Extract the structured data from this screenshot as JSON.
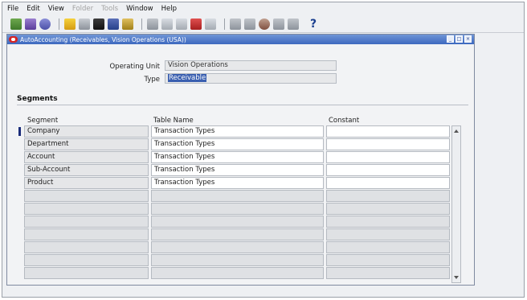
{
  "menubar": {
    "items": [
      {
        "label": "File",
        "enabled": true
      },
      {
        "label": "Edit",
        "enabled": true
      },
      {
        "label": "View",
        "enabled": true
      },
      {
        "label": "Folder",
        "enabled": false
      },
      {
        "label": "Tools",
        "enabled": false
      },
      {
        "label": "Window",
        "enabled": true
      },
      {
        "label": "Help",
        "enabled": true
      }
    ]
  },
  "toolbar": {
    "help_glyph": "?"
  },
  "window": {
    "title": "AutoAccounting (Receivables, Vision Operations (USA))",
    "controls": [
      "minimize",
      "maximize",
      "close"
    ]
  },
  "form": {
    "operating_unit_label": "Operating Unit",
    "operating_unit_value": "Vision Operations",
    "type_label": "Type",
    "type_value": "Receivable"
  },
  "segments": {
    "section_title": "Segments",
    "columns": {
      "segment": "Segment",
      "table_name": "Table Name",
      "constant": "Constant"
    },
    "rows": [
      {
        "segment": "Company",
        "table_name": "Transaction Types",
        "constant": ""
      },
      {
        "segment": "Department",
        "table_name": "Transaction Types",
        "constant": ""
      },
      {
        "segment": "Account",
        "table_name": "Transaction Types",
        "constant": ""
      },
      {
        "segment": "Sub-Account",
        "table_name": "Transaction Types",
        "constant": ""
      },
      {
        "segment": "Product",
        "table_name": "Transaction Types",
        "constant": ""
      },
      {
        "segment": "",
        "table_name": "",
        "constant": ""
      },
      {
        "segment": "",
        "table_name": "",
        "constant": ""
      },
      {
        "segment": "",
        "table_name": "",
        "constant": ""
      },
      {
        "segment": "",
        "table_name": "",
        "constant": ""
      },
      {
        "segment": "",
        "table_name": "",
        "constant": ""
      },
      {
        "segment": "",
        "table_name": "",
        "constant": ""
      },
      {
        "segment": "",
        "table_name": "",
        "constant": ""
      }
    ]
  },
  "colors": {
    "title_bar": "#3d68bf",
    "selection": "#3a5fb0",
    "indicator": "#1a2c7a"
  }
}
